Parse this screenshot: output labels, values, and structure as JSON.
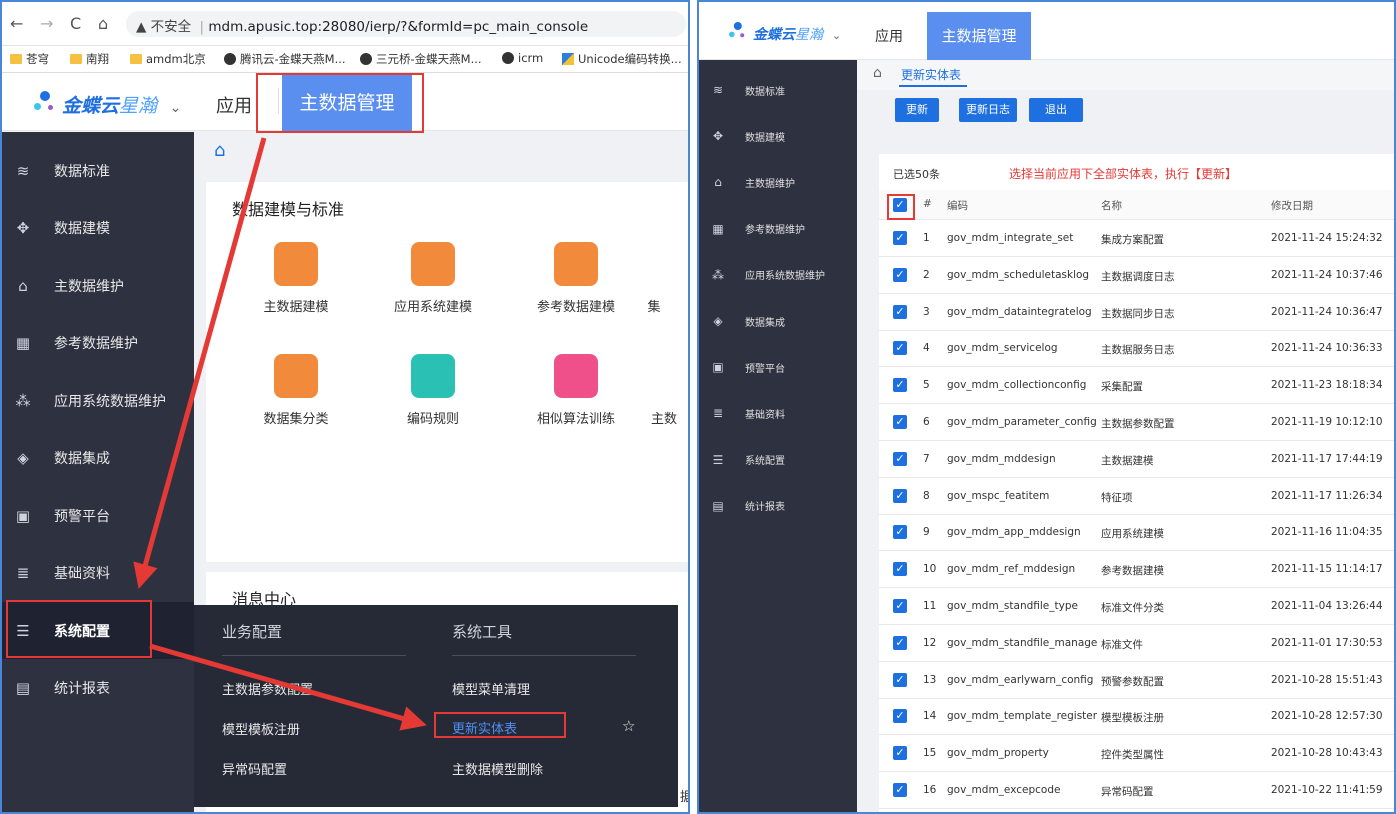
{
  "left": {
    "browser": {
      "back": "←",
      "forward": "→",
      "reload": "C",
      "home": "⌂",
      "security": "▲ 不安全",
      "url": "mdm.apusic.top:28080/ierp/?&formId=pc_main_console",
      "bookmarks": [
        "苍穹",
        "南翔",
        "amdm北京",
        "腾讯云-金蝶天燕M...",
        "三元桥-金蝶天燕M...",
        "icrm",
        "Unicode编码转换..."
      ]
    },
    "header": {
      "logo": "金蝶云",
      "logo2": "星瀚",
      "logo_caret": "⌄",
      "app": "应用",
      "mdm": "主数据管理"
    },
    "sidebar": [
      {
        "label": "数据标准",
        "icon": "≋"
      },
      {
        "label": "数据建模",
        "icon": "✥"
      },
      {
        "label": "主数据维护",
        "icon": "⌂"
      },
      {
        "label": "参考数据维护",
        "icon": "▦"
      },
      {
        "label": "应用系统数据维护",
        "icon": "⁂"
      },
      {
        "label": "数据集成",
        "icon": "◈"
      },
      {
        "label": "预警平台",
        "icon": "▣"
      },
      {
        "label": "基础资料",
        "icon": "≣"
      },
      {
        "label": "系统配置",
        "icon": "☰"
      },
      {
        "label": "统计报表",
        "icon": "▤"
      }
    ],
    "home_icon": "⌂",
    "card1": {
      "title": "数据建模与标准",
      "tiles": [
        "主数据建模",
        "应用系统建模",
        "参考数据建模",
        "集",
        "数据集分类",
        "编码规则",
        "相似算法训练",
        "主数"
      ]
    },
    "card2": {
      "title": "消息中心",
      "tail": "据"
    },
    "flyout": {
      "col1_title": "业务配置",
      "col2_title": "系统工具",
      "col1": [
        "主数据参数配置",
        "模型模板注册",
        "异常码配置"
      ],
      "col2": [
        "模型菜单清理",
        "更新实体表",
        "主数据模型删除"
      ],
      "star": "☆"
    }
  },
  "right": {
    "header": {
      "logo": "金蝶云",
      "logo2": "星瀚",
      "logo_caret": "⌄",
      "app": "应用",
      "mdm": "主数据管理"
    },
    "sidebar": [
      {
        "label": "数据标准",
        "icon": "≋"
      },
      {
        "label": "数据建模",
        "icon": "✥"
      },
      {
        "label": "主数据维护",
        "icon": "⌂"
      },
      {
        "label": "参考数据维护",
        "icon": "▦"
      },
      {
        "label": "应用系统数据维护",
        "icon": "⁂"
      },
      {
        "label": "数据集成",
        "icon": "◈"
      },
      {
        "label": "预警平台",
        "icon": "▣"
      },
      {
        "label": "基础资料",
        "icon": "≣"
      },
      {
        "label": "系统配置",
        "icon": "☰"
      },
      {
        "label": "统计报表",
        "icon": "▤"
      }
    ],
    "breadcrumb": {
      "home": "⌂",
      "page": "更新实体表"
    },
    "buttons": {
      "update": "更新",
      "log": "更新日志",
      "exit": "退出"
    },
    "selected": "已选50条",
    "note": "选择当前应用下全部实体表，执行【更新】",
    "table": {
      "headers": [
        "#",
        "编码",
        "名称",
        "修改日期"
      ],
      "rows": [
        {
          "n": "1",
          "code": "gov_mdm_integrate_set",
          "name": "集成方案配置",
          "date": "2021-11-24 15:24:32"
        },
        {
          "n": "2",
          "code": "gov_mdm_scheduletasklog",
          "name": "主数据调度日志",
          "date": "2021-11-24 10:37:46"
        },
        {
          "n": "3",
          "code": "gov_mdm_dataintegratelog",
          "name": "主数据同步日志",
          "date": "2021-11-24 10:36:47"
        },
        {
          "n": "4",
          "code": "gov_mdm_servicelog",
          "name": "主数据服务日志",
          "date": "2021-11-24 10:36:33"
        },
        {
          "n": "5",
          "code": "gov_mdm_collectionconfig",
          "name": "采集配置",
          "date": "2021-11-23 18:18:34"
        },
        {
          "n": "6",
          "code": "gov_mdm_parameter_config",
          "name": "主数据参数配置",
          "date": "2021-11-19 10:12:10"
        },
        {
          "n": "7",
          "code": "gov_mdm_mddesign",
          "name": "主数据建模",
          "date": "2021-11-17 17:44:19"
        },
        {
          "n": "8",
          "code": "gov_mspc_featitem",
          "name": "特征项",
          "date": "2021-11-17 11:26:34"
        },
        {
          "n": "9",
          "code": "gov_mdm_app_mddesign",
          "name": "应用系统建模",
          "date": "2021-11-16 11:04:35"
        },
        {
          "n": "10",
          "code": "gov_mdm_ref_mddesign",
          "name": "参考数据建模",
          "date": "2021-11-15 11:14:17"
        },
        {
          "n": "11",
          "code": "gov_mdm_standfile_type",
          "name": "标准文件分类",
          "date": "2021-11-04 13:26:44"
        },
        {
          "n": "12",
          "code": "gov_mdm_standfile_manage",
          "name": "标准文件",
          "date": "2021-11-01 17:30:53"
        },
        {
          "n": "13",
          "code": "gov_mdm_earlywarn_config",
          "name": "预警参数配置",
          "date": "2021-10-28 15:51:43"
        },
        {
          "n": "14",
          "code": "gov_mdm_template_register",
          "name": "模型模板注册",
          "date": "2021-10-28 12:57:30"
        },
        {
          "n": "15",
          "code": "gov_mdm_property",
          "name": "控件类型属性",
          "date": "2021-10-28 10:43:43"
        },
        {
          "n": "16",
          "code": "gov_mdm_excepcode",
          "name": "异常码配置",
          "date": "2021-10-22 11:41:59"
        }
      ]
    }
  },
  "colors": {
    "accent": "#1e6fe0",
    "sidebar": "#2e3240",
    "highlight": "#e53935",
    "mdm_tab": "#5a8ff0"
  }
}
